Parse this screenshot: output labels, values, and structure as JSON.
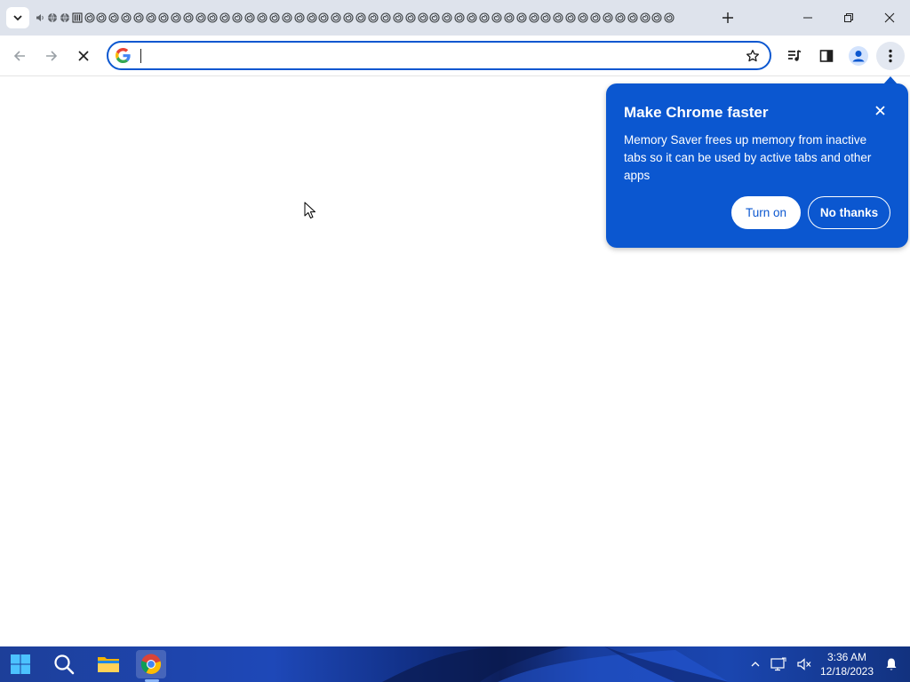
{
  "browser": {
    "tab_favicons": [
      "speaker-icon",
      "globe-icon",
      "globe-icon",
      "columns-icon",
      "spiral-icon",
      "spiral-icon",
      "spiral-icon",
      "spiral-icon",
      "spiral-icon",
      "spiral-icon",
      "spiral-icon",
      "spiral-icon",
      "spiral-icon",
      "spiral-icon",
      "spiral-icon",
      "spiral-icon",
      "spiral-icon",
      "spiral-icon",
      "spiral-icon",
      "spiral-icon",
      "spiral-icon",
      "spiral-icon",
      "spiral-icon",
      "spiral-icon",
      "spiral-icon",
      "spiral-icon",
      "spiral-icon",
      "spiral-icon",
      "spiral-icon",
      "spiral-icon",
      "spiral-icon",
      "spiral-icon",
      "spiral-icon",
      "spiral-icon",
      "spiral-icon",
      "spiral-icon",
      "spiral-icon",
      "spiral-icon",
      "spiral-icon",
      "spiral-icon",
      "spiral-icon",
      "spiral-icon",
      "spiral-icon",
      "spiral-icon",
      "spiral-icon",
      "spiral-icon",
      "spiral-icon",
      "spiral-icon",
      "spiral-icon",
      "spiral-icon",
      "spiral-icon",
      "spiral-icon"
    ],
    "omnibox": {
      "value": "",
      "placeholder": ""
    },
    "accent_color": "#0b57d0"
  },
  "popup": {
    "title": "Make Chrome faster",
    "body": "Memory Saver frees up memory from inactive tabs so it can be used by active tabs and other apps",
    "primary_button": "Turn on",
    "secondary_button": "No thanks",
    "background_color": "#0b57d0"
  },
  "taskbar": {
    "time": "3:36 AM",
    "date": "12/18/2023",
    "pinned": [
      "windows-start-icon",
      "search-icon",
      "file-explorer-icon",
      "chrome-icon"
    ]
  }
}
